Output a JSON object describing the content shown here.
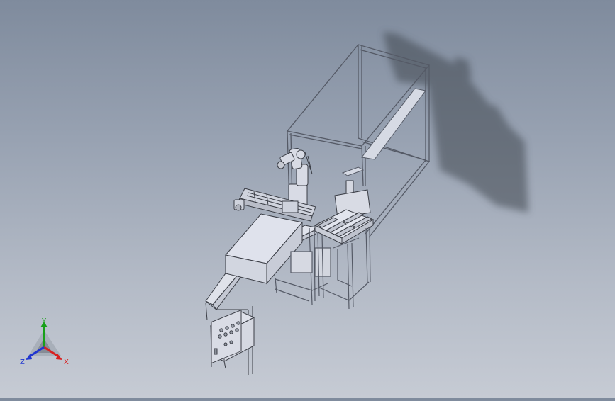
{
  "scene": {
    "background_top": "#7f8b9d",
    "background_bottom": "#c6cbd4",
    "model_line_color": "#4a4e58",
    "model_face_color": "#d9dce6",
    "shadow_color": "#3f4650"
  },
  "triad": {
    "x_label": "X",
    "y_label": "Y",
    "z_label": "Z",
    "x_color": "#d82020",
    "y_color": "#18a018",
    "z_color": "#2036d0",
    "x_icon": "axis-x-arrow-icon",
    "y_icon": "axis-y-arrow-icon",
    "z_icon": "axis-z-arrow-icon"
  }
}
